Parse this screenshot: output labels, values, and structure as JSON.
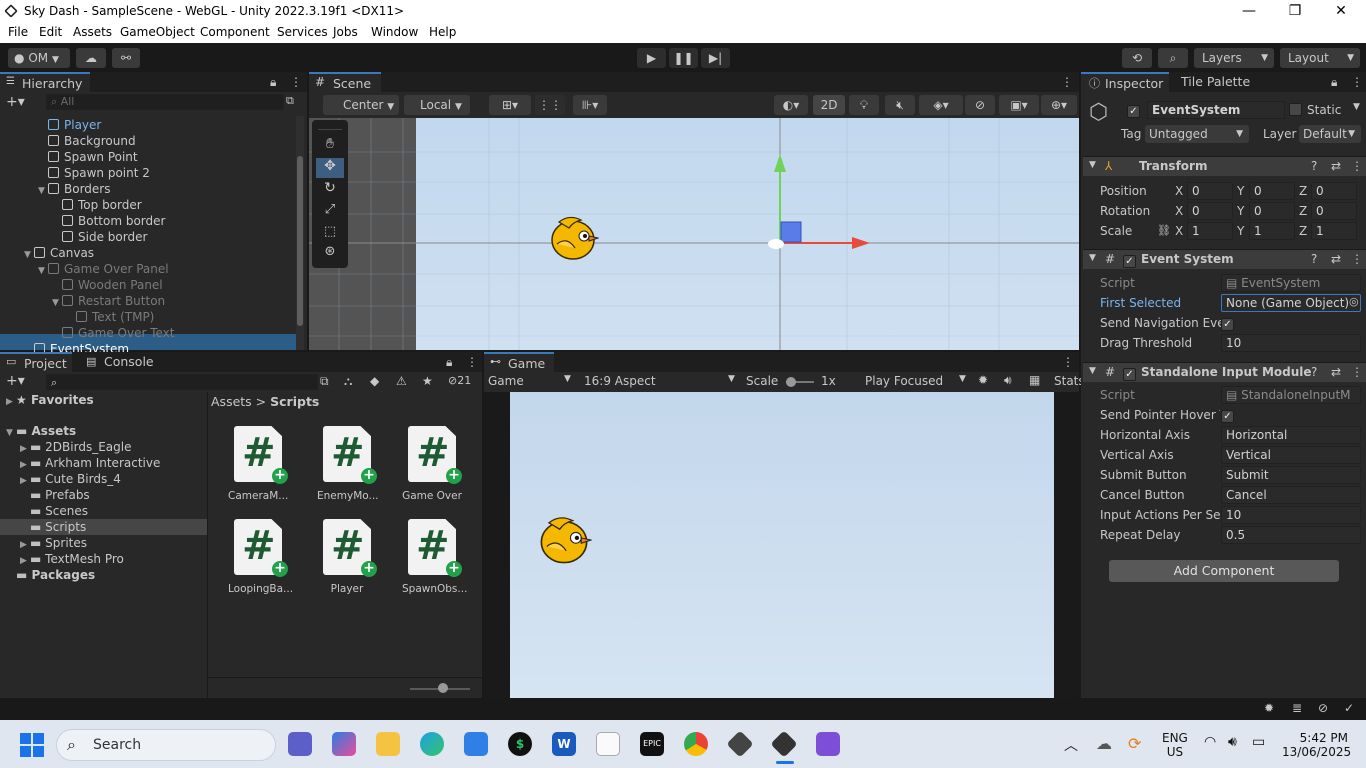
{
  "window": {
    "title": "Sky Dash - SampleScene - WebGL - Unity 2022.3.19f1 <DX11>"
  },
  "menu": [
    "File",
    "Edit",
    "Assets",
    "GameObject",
    "Component",
    "Services",
    "Jobs",
    "Window",
    "Help"
  ],
  "toolbar": {
    "account": "OM",
    "layers": "Layers",
    "layout": "Layout"
  },
  "hierarchy": {
    "tab": "Hierarchy",
    "search_placeholder": "All",
    "items": [
      {
        "label": "Player",
        "indent": 3,
        "arrow": "",
        "state": "selected-text"
      },
      {
        "label": "Background",
        "indent": 3,
        "arrow": "",
        "state": "normal"
      },
      {
        "label": "Spawn Point",
        "indent": 3,
        "arrow": "",
        "state": "normal"
      },
      {
        "label": "Spawn point 2",
        "indent": 3,
        "arrow": "",
        "state": "normal"
      },
      {
        "label": "Borders",
        "indent": 3,
        "arrow": "▼",
        "state": "normal"
      },
      {
        "label": "Top border",
        "indent": 4,
        "arrow": "",
        "state": "normal"
      },
      {
        "label": "Bottom border",
        "indent": 4,
        "arrow": "",
        "state": "normal"
      },
      {
        "label": "Side border",
        "indent": 4,
        "arrow": "",
        "state": "normal"
      },
      {
        "label": "Canvas",
        "indent": 2,
        "arrow": "▼",
        "state": "normal"
      },
      {
        "label": "Game Over Panel",
        "indent": 3,
        "arrow": "▼",
        "state": "dim"
      },
      {
        "label": "Wooden Panel",
        "indent": 4,
        "arrow": "",
        "state": "dim"
      },
      {
        "label": "Restart Button",
        "indent": 4,
        "arrow": "▼",
        "state": "dim"
      },
      {
        "label": "Text (TMP)",
        "indent": 5,
        "arrow": "",
        "state": "dim"
      },
      {
        "label": "Game Over Text",
        "indent": 4,
        "arrow": "",
        "state": "dim"
      },
      {
        "label": "EventSystem",
        "indent": 2,
        "arrow": "",
        "state": "selected"
      }
    ]
  },
  "scene": {
    "tab": "Scene",
    "pivot": "Center",
    "space": "Local",
    "mode2d": "2D"
  },
  "project": {
    "tabs": [
      "Project",
      "Console"
    ],
    "hidden_count": "21",
    "favorites": "Favorites",
    "assets_root": "Assets",
    "folders": [
      "2DBirds_Eagle",
      "Arkham Interactive",
      "Cute Birds_4",
      "Prefabs",
      "Scenes",
      "Scripts",
      "Sprites",
      "TextMesh Pro"
    ],
    "packages": "Packages",
    "breadcrumb": [
      "Assets",
      "Scripts"
    ],
    "breadcrumb_sep": ">",
    "files": [
      "CameraM...",
      "EnemyMo...",
      "Game Over",
      "LoopingBa...",
      "Player",
      "SpawnObs..."
    ]
  },
  "game": {
    "tab": "Game",
    "display": "Game",
    "aspect": "16:9 Aspect",
    "scale_label": "Scale",
    "scale_value": "1x",
    "play_mode": "Play Focused",
    "stats": "Stats"
  },
  "inspector": {
    "tabs": [
      "Inspector",
      "Tile Palette"
    ],
    "object_name": "EventSystem",
    "static_label": "Static",
    "tag_label": "Tag",
    "tag_value": "Untagged",
    "layer_label": "Layer",
    "layer_value": "Default",
    "transform": {
      "title": "Transform",
      "rows": [
        {
          "label": "Position",
          "x": "0",
          "y": "0",
          "z": "0"
        },
        {
          "label": "Rotation",
          "x": "0",
          "y": "0",
          "z": "0"
        },
        {
          "label": "Scale",
          "x": "1",
          "y": "1",
          "z": "1"
        }
      ]
    },
    "event_system": {
      "title": "Event System",
      "script_label": "Script",
      "script_value": "EventSystem",
      "first_selected_label": "First Selected",
      "first_selected_value": "None (Game Object)",
      "send_nav_label": "Send Navigation Ever",
      "drag_threshold_label": "Drag Threshold",
      "drag_threshold_value": "10"
    },
    "input_module": {
      "title": "Standalone Input Module",
      "script_label": "Script",
      "script_value": "StandaloneInputM",
      "rows": [
        {
          "label": "Send Pointer Hover T",
          "value": "✓"
        },
        {
          "label": "Horizontal Axis",
          "value": "Horizontal"
        },
        {
          "label": "Vertical Axis",
          "value": "Vertical"
        },
        {
          "label": "Submit Button",
          "value": "Submit"
        },
        {
          "label": "Cancel Button",
          "value": "Cancel"
        },
        {
          "label": "Input Actions Per Sec",
          "value": "10"
        },
        {
          "label": "Repeat Delay",
          "value": "0.5"
        }
      ]
    },
    "add_component": "Add Component"
  },
  "taskbar": {
    "search": "Search",
    "lang1": "ENG",
    "lang2": "US",
    "time": "5:42 PM",
    "date": "13/06/2025"
  }
}
